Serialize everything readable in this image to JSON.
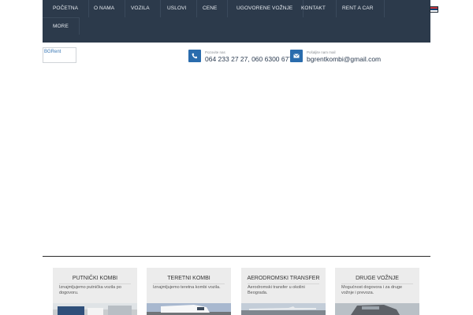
{
  "nav": {
    "items": [
      "POČETNA",
      "O NAMA",
      "VOZILA",
      "USLOVI",
      "CENE",
      "UGOVORENE VOŽNJE",
      "KONTAKT",
      "RENT A CAR"
    ],
    "more_label": "MORE",
    "language_flag": "serbian-flag-icon"
  },
  "logo": {
    "alt_text": "BGRent"
  },
  "contacts": [
    {
      "caption": "Pozovite nas",
      "value": "064 233 27 27, 060 6300 677",
      "icon": "phone-icon"
    },
    {
      "caption": "Pošaljite nam mail",
      "value": "bgrentkombi@gmail.com",
      "icon": "mail-icon"
    }
  ],
  "services": [
    {
      "title": "PUTNIČKI KOMBI",
      "text": "Iznajmljujemo putnička vozila po dogovoru."
    },
    {
      "title": "TERETNI KOMBI",
      "text": "Iznajmljujemo teretna kombi vozila."
    },
    {
      "title": "AERODROMSKI TRANSFER",
      "text": "Aerodromski transfer u okolini Beograda."
    },
    {
      "title": "DRUGE VOŽNJE",
      "text": "Mogućnost dogovora i za druge vožnje i prevoza."
    }
  ],
  "colors": {
    "nav_bg": "#2c3a4b",
    "accent": "#2a6cad",
    "card_bg": "#ececec"
  }
}
